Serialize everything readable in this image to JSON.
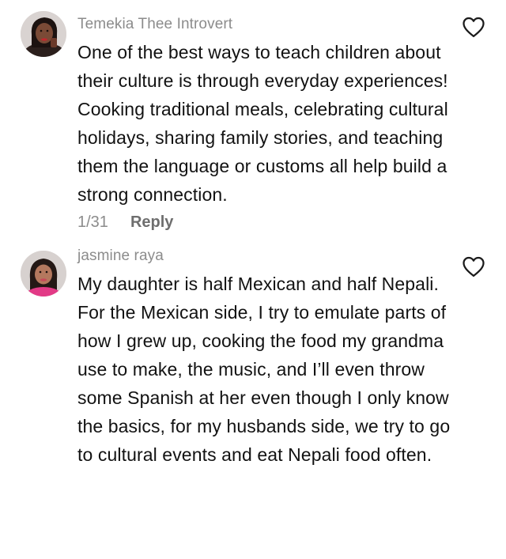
{
  "comments": [
    {
      "username": "Temekia Thee Introvert",
      "text": "One of the best ways to teach children about their culture is through everyday experiences! Cooking traditional meals, celebrating cultural holidays, sharing family stories, and teaching them the language or customs all help build a strong connection.",
      "date": "1/31",
      "reply_label": "Reply",
      "avatar_icon": "avatar-woman-red-lips",
      "like_icon": "heart-outline-icon"
    },
    {
      "username": "jasmine raya",
      "text": "My daughter is half Mexican and half Nepali. For the Mexican side, I try to emulate parts of how I grew up, cooking the food my grandma use to make, the music, and I’ll even throw some Spanish at her even though I only know the basics, for my husbands side, we try to go to cultural events and eat Nepali food often.",
      "avatar_icon": "avatar-woman-pink-top",
      "like_icon": "heart-outline-icon"
    }
  ]
}
